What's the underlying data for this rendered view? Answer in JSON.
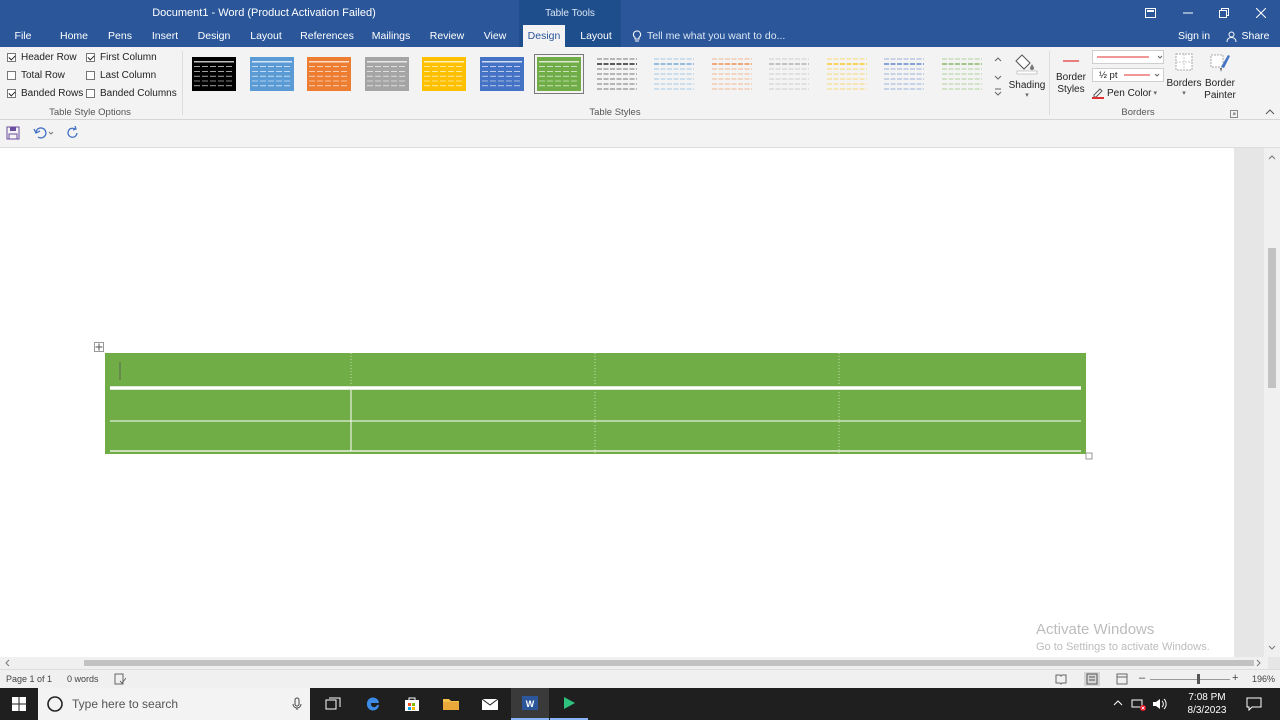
{
  "title_bar": {
    "document_title": "Document1 - Word (Product Activation Failed)",
    "context_title": "Table Tools",
    "buttons": [
      "restore-ribbon-icon",
      "minimize-icon",
      "maximize-icon",
      "close-icon"
    ]
  },
  "tabs": [
    {
      "label": "File"
    },
    {
      "label": "Home"
    },
    {
      "label": "Pens"
    },
    {
      "label": "Insert"
    },
    {
      "label": "Design"
    },
    {
      "label": "Layout"
    },
    {
      "label": "References"
    },
    {
      "label": "Mailings"
    },
    {
      "label": "Review"
    },
    {
      "label": "View"
    },
    {
      "label": "Design"
    },
    {
      "label": "Layout"
    }
  ],
  "tell_me": "Tell me what you want to do...",
  "sign_in": "Sign in",
  "share": "Share",
  "style_options": {
    "items": [
      {
        "label": "Header Row",
        "checked": true
      },
      {
        "label": "Total Row",
        "checked": false
      },
      {
        "label": "Banded Rows",
        "checked": true
      },
      {
        "label": "First Column",
        "checked": true
      },
      {
        "label": "Last Column",
        "checked": false
      },
      {
        "label": "Banded Columns",
        "checked": false
      }
    ],
    "group_label": "Table Style Options"
  },
  "table_styles": {
    "group_label": "Table Styles",
    "swatch_colors": [
      "#000000",
      "#5b9bd5",
      "#ed7d31",
      "#a5a5a5",
      "#ffc000",
      "#4472c4",
      "#70ad47",
      "#000000",
      "#5b9bd5",
      "#ed7d31",
      "#a5a5a5",
      "#ffc000",
      "#4472c4",
      "#70ad47"
    ],
    "selected_index": 6
  },
  "shading": {
    "label": "Shading"
  },
  "borders_group": {
    "border_styles": "Border Styles",
    "pen_weight": "½ pt",
    "pen_color": "Pen Color",
    "borders": "Borders",
    "border_painter": "Border Painter",
    "group_label": "Borders",
    "pen_color_value": "#e03030"
  },
  "table_fill": "#70ad47",
  "status": {
    "page": "Page 1 of 1",
    "words": "0 words",
    "zoom": "196%"
  },
  "watermark": {
    "line1": "Activate Windows",
    "line2": "Go to Settings to activate Windows."
  },
  "taskbar": {
    "search_placeholder": "Type here to search",
    "time": "7:08 PM",
    "date": "8/3/2023"
  }
}
